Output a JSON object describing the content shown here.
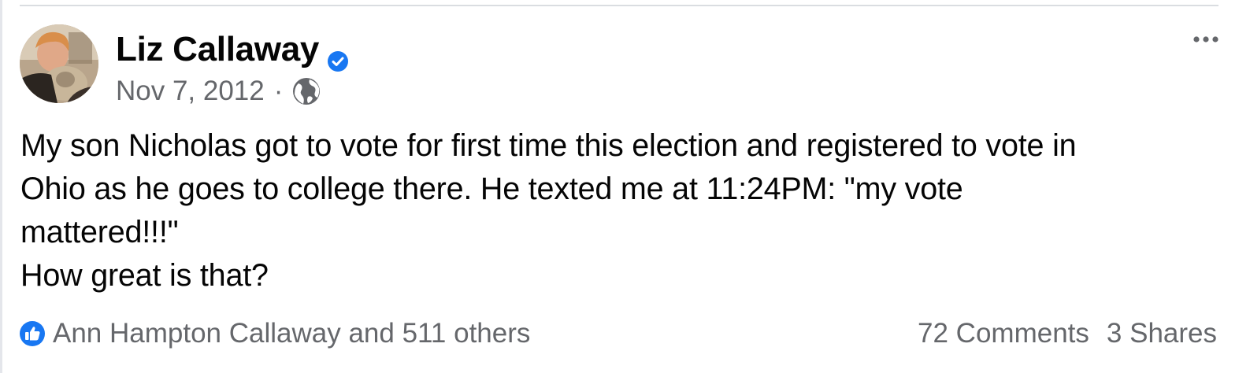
{
  "post": {
    "author": "Liz Callaway",
    "date": "Nov 7, 2012",
    "separator": "·",
    "text": "My son Nicholas got to vote for first time this election and registered to vote in\nOhio as he goes to college there. He texted me at 11:24PM:  \"my vote\nmattered!!!\"\nHow great is that?"
  },
  "engagement": {
    "reactions_text": "Ann Hampton Callaway and 511 others",
    "comments": "72 Comments",
    "shares": "3 Shares"
  },
  "colors": {
    "accent": "#1877f2",
    "secondary_text": "#65676b",
    "primary_text": "#050505",
    "divider": "#dadde1"
  },
  "icons": {
    "verified": "verified-badge-icon",
    "audience": "globe-icon",
    "menu": "more-options-icon",
    "reaction": "like-icon"
  }
}
